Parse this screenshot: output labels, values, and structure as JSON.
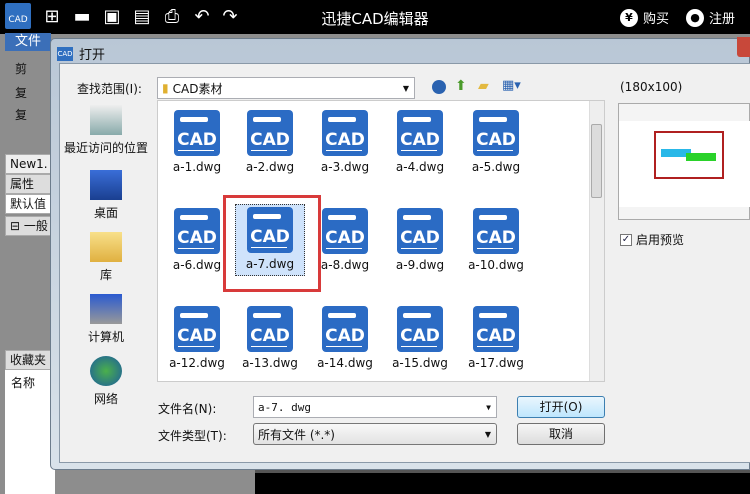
{
  "app": {
    "title": "迅捷CAD编辑器",
    "logo": "CAD",
    "buy": "购买",
    "register": "注册",
    "buy_icon": "¥",
    "toolbar_icons": [
      "new-icon",
      "open-icon",
      "save-icon",
      "save-pdf-icon",
      "print-icon",
      "undo-icon",
      "redo-icon"
    ]
  },
  "ribbon": {
    "file_tab": "文件",
    "left_items": [
      "剪",
      "复",
      "复"
    ],
    "doc_tab": "New1.",
    "panel_items": [
      "属性",
      "默认值",
      "⊟ 一般"
    ],
    "favorites": "收藏夹",
    "name_col": "名称"
  },
  "dialog": {
    "title": "打开",
    "icon_text": "CAD",
    "look_in_label": "查找范围(I):",
    "look_in_value": "CAD素材",
    "places": [
      "最近访问的位置",
      "桌面",
      "库",
      "计算机",
      "网络"
    ],
    "files": [
      "a-1.dwg",
      "a-2.dwg",
      "a-3.dwg",
      "a-4.dwg",
      "a-5.dwg",
      "a-6.dwg",
      "a-7.dwg",
      "a-8.dwg",
      "a-9.dwg",
      "a-10.dwg",
      "a-12.dwg",
      "a-13.dwg",
      "a-14.dwg",
      "a-15.dwg",
      "a-17.dwg"
    ],
    "file_icon_text": "CAD",
    "selected": "a-7.dwg",
    "preview_size": "(180x100)",
    "enable_preview": "启用预览",
    "filename_label": "文件名(N):",
    "filename_value": "a-7. dwg",
    "filetype_label": "文件类型(T):",
    "filetype_value": "所有文件 (*.*)",
    "open_button": "打开(O)",
    "cancel_button": "取消"
  }
}
